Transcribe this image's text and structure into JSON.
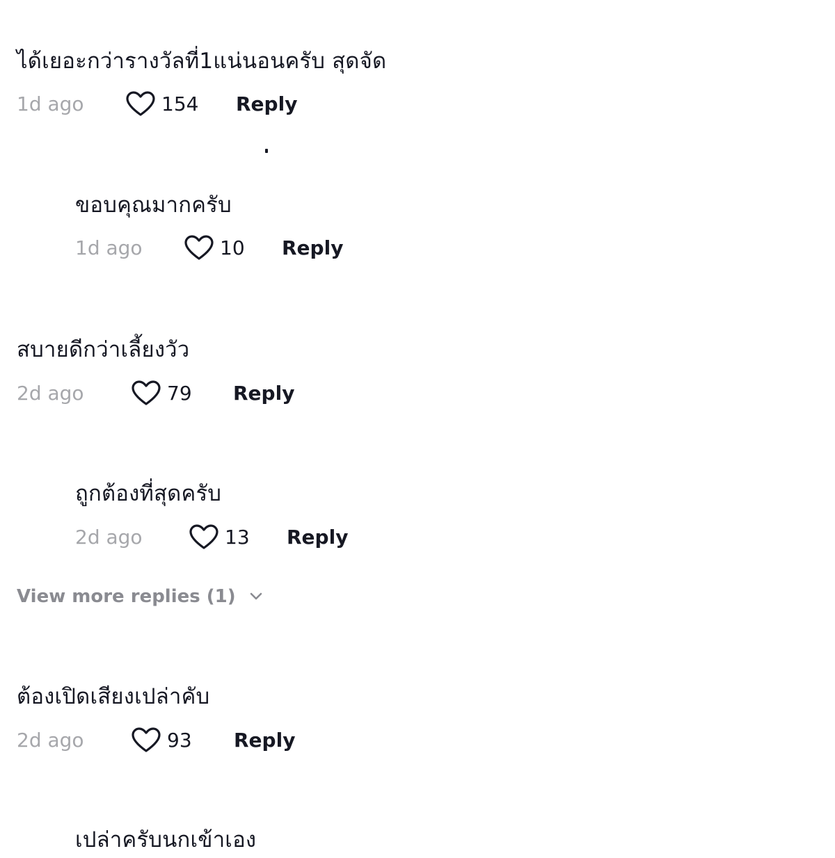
{
  "comments": [
    {
      "text": "ได้เยอะกว่ารางวัลที่1แน่นอนครับ สุดจัด",
      "time": "1d ago",
      "likes": "154",
      "reply_label": "Reply"
    },
    {
      "text": "ขอบคุณมากครับ",
      "time": "1d ago",
      "likes": "10",
      "reply_label": "Reply"
    },
    {
      "text": "สบายดีกว่าเลี้ยงวัว",
      "time": "2d ago",
      "likes": "79",
      "reply_label": "Reply"
    },
    {
      "text": "ถูกต้องที่สุดครับ",
      "time": "2d ago",
      "likes": "13",
      "reply_label": "Reply"
    },
    {
      "text": "ต้องเปิดเสียงเปล่าคับ",
      "time": "2d ago",
      "likes": "93",
      "reply_label": "Reply"
    },
    {
      "text": "เปล่าครับนกเข้าเอง"
    }
  ],
  "view_more": {
    "label": "View more replies (1)",
    "icon": "chevron-down-icon"
  },
  "colors": {
    "text": "#161823",
    "muted": "#a6a7ab",
    "view_more": "#8a8b91"
  }
}
